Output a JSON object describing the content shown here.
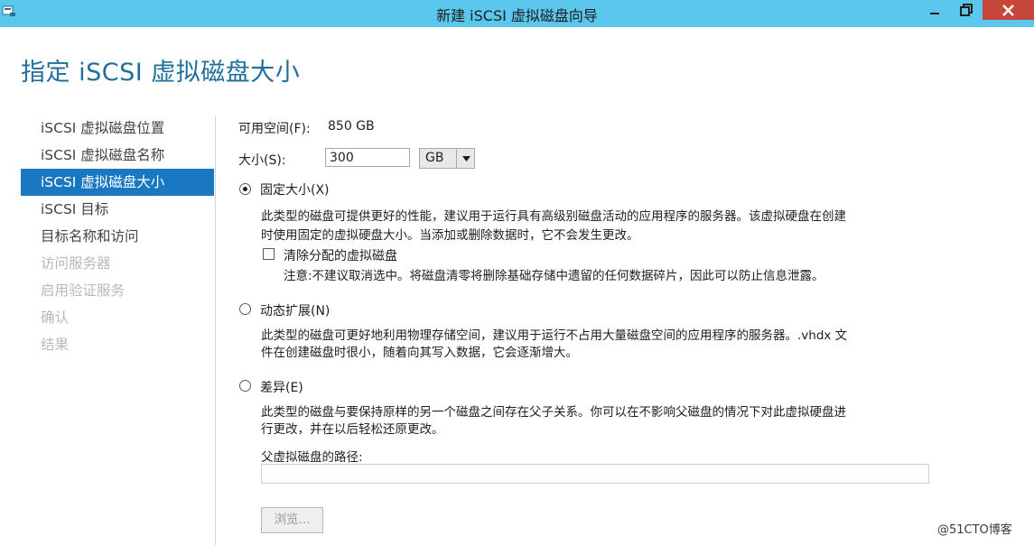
{
  "window": {
    "title": "新建 iSCSI 虚拟磁盘向导",
    "accent": "#5bc7ec",
    "close_color": "#c7463b",
    "buttons": [
      "minimize-icon",
      "restore-icon",
      "close-icon"
    ]
  },
  "page_title": "指定 iSCSI 虚拟磁盘大小",
  "nav": {
    "items": [
      {
        "label": "iSCSI 虚拟磁盘位置",
        "state": "done"
      },
      {
        "label": "iSCSI 虚拟磁盘名称",
        "state": "done"
      },
      {
        "label": "iSCSI 虚拟磁盘大小",
        "state": "selected"
      },
      {
        "label": "iSCSI 目标",
        "state": "enabled"
      },
      {
        "label": "目标名称和访问",
        "state": "enabled"
      },
      {
        "label": "访问服务器",
        "state": "disabled"
      },
      {
        "label": "启用验证服务",
        "state": "disabled"
      },
      {
        "label": "确认",
        "state": "disabled"
      },
      {
        "label": "结果",
        "state": "disabled"
      }
    ],
    "selected_color": "#1a78c2"
  },
  "form": {
    "free_space_label": "可用空间(F):",
    "free_space_value": "850 GB",
    "size_label": "大小(S):",
    "size_value": "300",
    "unit_value": "GB",
    "fixed": {
      "label": "固定大小(X)",
      "checked": true,
      "desc_line1": "此类型的磁盘可提供更好的性能，建议用于运行具有高级别磁盘活动的应用程序的服务器。该虚拟硬盘在创建",
      "desc_line2": "时使用固定的虚拟硬盘大小。当添加或删除数据时，它不会发生更改。",
      "clear_label": "清除分配的虚拟磁盘",
      "clear_checked": false,
      "note": "注意:不建议取消选中。将磁盘清零将删除基础存储中遗留的任何数据碎片，因此可以防止信息泄露。"
    },
    "dynamic": {
      "label": "动态扩展(N)",
      "checked": false,
      "desc_line1": "此类型的磁盘可更好地利用物理存储空间，建议用于运行不占用大量磁盘空间的应用程序的服务器。.vhdx 文",
      "desc_line2": "件在创建磁盘时很小，随着向其写入数据，它会逐渐增大。"
    },
    "differencing": {
      "label": "差异(E)",
      "checked": false,
      "desc_line1": "此类型的磁盘与要保持原样的另一个磁盘之间存在父子关系。你可以在不影响父磁盘的情况下对此虚拟硬盘进",
      "desc_line2": "行更改，并在以后轻松还原更改。",
      "parent_path_label": "父虚拟磁盘的路径:",
      "parent_path_value": "",
      "browse_label": "浏览..."
    }
  },
  "watermark": "@51CTO博客"
}
